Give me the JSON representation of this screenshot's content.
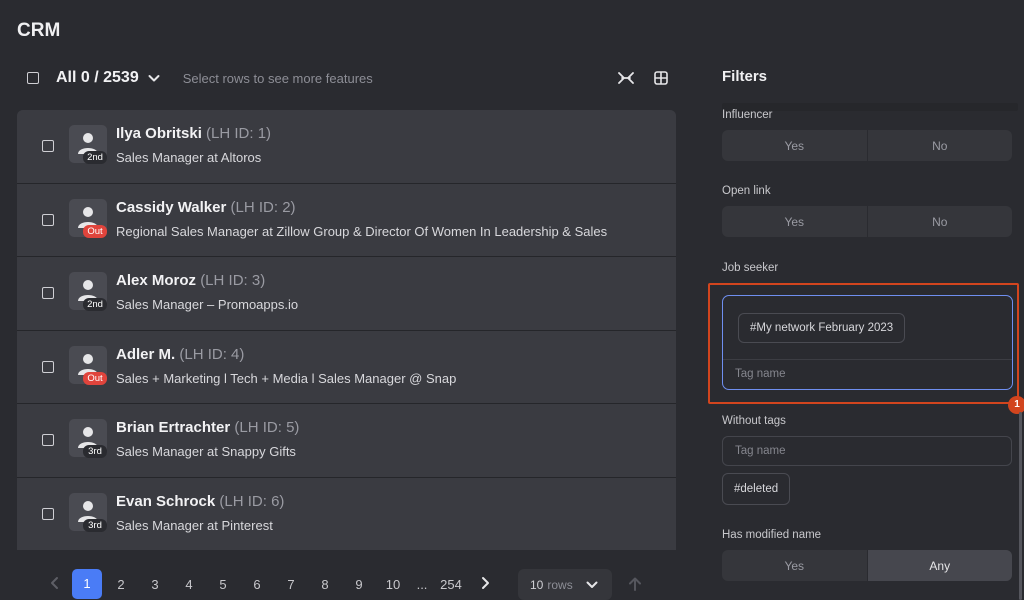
{
  "app": {
    "title": "CRM"
  },
  "toolbar": {
    "all_label": "All 0 / 2539",
    "hint": "Select rows to see more features",
    "icons": [
      "collapse-icon",
      "grid-icon"
    ]
  },
  "contacts": [
    {
      "name": "Ilya Obritski",
      "lh_id": "(LH ID: 1)",
      "title": "Sales Manager at Altoros",
      "degree": "2nd",
      "degree_type": "connection"
    },
    {
      "name": "Cassidy Walker",
      "lh_id": "(LH ID: 2)",
      "title": "Regional Sales Manager at Zillow Group & Director Of Women In Leadership & Sales",
      "degree": "Out",
      "degree_type": "out"
    },
    {
      "name": "Alex Moroz",
      "lh_id": "(LH ID: 3)",
      "title": "Sales Manager – Promoapps.io",
      "degree": "2nd",
      "degree_type": "connection"
    },
    {
      "name": "Adler M.",
      "lh_id": "(LH ID: 4)",
      "title": "Sales + Marketing l Tech + Media l Sales Manager @ Snap",
      "degree": "Out",
      "degree_type": "out"
    },
    {
      "name": "Brian Ertrachter",
      "lh_id": "(LH ID: 5)",
      "title": "Sales Manager at Snappy Gifts",
      "degree": "3rd",
      "degree_type": "connection"
    },
    {
      "name": "Evan Schrock",
      "lh_id": "(LH ID: 6)",
      "title": "Sales Manager at Pinterest",
      "degree": "3rd",
      "degree_type": "connection"
    }
  ],
  "pagination": {
    "pages": [
      "1",
      "2",
      "3",
      "4",
      "5",
      "6",
      "7",
      "8",
      "9",
      "10",
      "...",
      "254"
    ],
    "current": "1",
    "rows_value": "10",
    "rows_label": "rows"
  },
  "filters": {
    "title": "Filters",
    "influencer": {
      "label": "Influencer",
      "yes": "Yes",
      "no": "No"
    },
    "open_link": {
      "label": "Open link",
      "yes": "Yes",
      "no": "No"
    },
    "job_seeker": {
      "label": "Job seeker"
    },
    "with_tags": {
      "tag": "#My network February 2023",
      "placeholder": "Tag name"
    },
    "without_tags": {
      "label": "Without tags",
      "placeholder": "Tag name",
      "tag": "#deleted"
    },
    "has_modified_name": {
      "label": "Has modified name",
      "yes": "Yes",
      "any": "Any"
    }
  },
  "highlight_badge": "1",
  "colors": {
    "accent": "#4a7cf6",
    "out_badge": "#e0443c",
    "highlight": "#d2451e",
    "focus": "#6f8ff0"
  }
}
